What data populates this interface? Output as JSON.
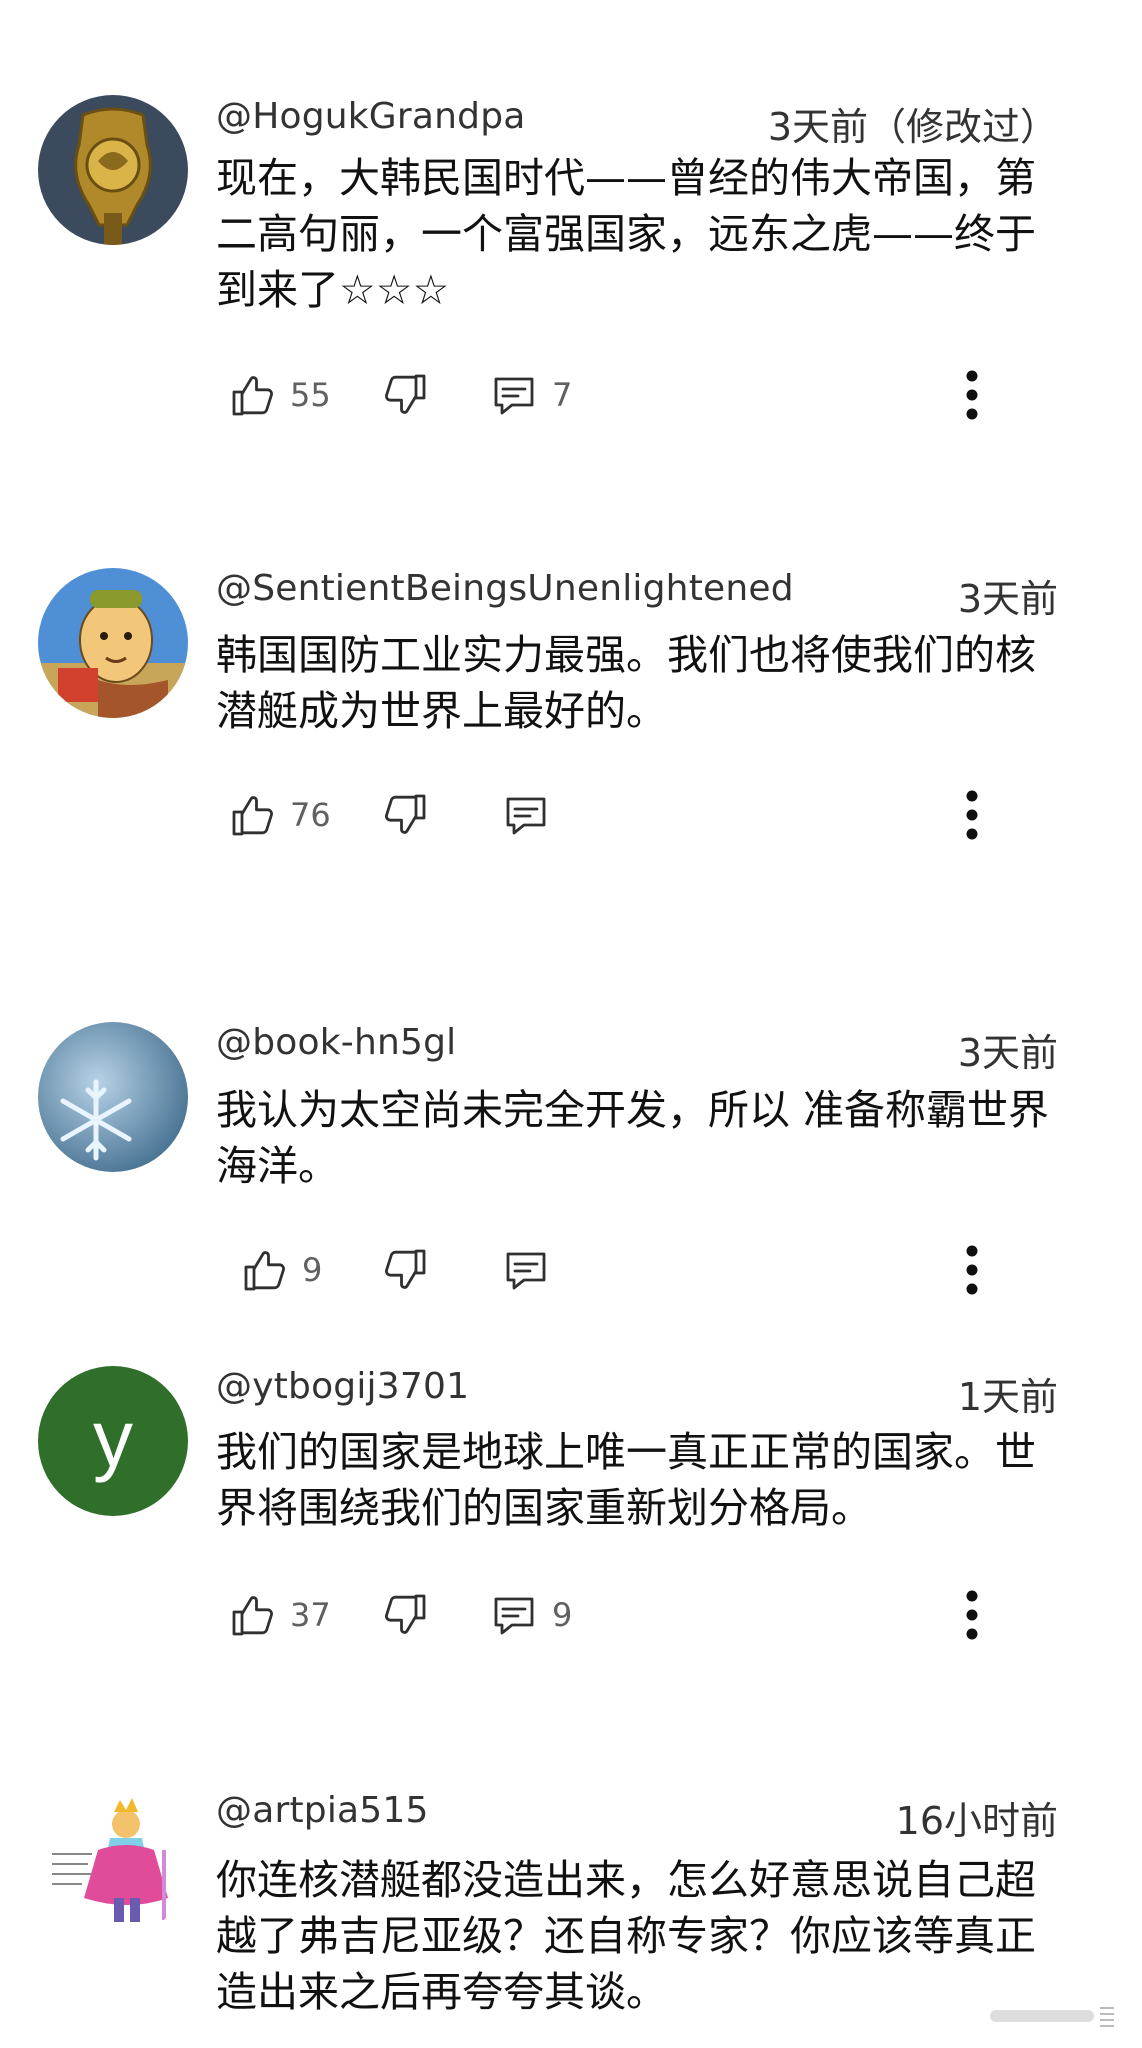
{
  "comments": [
    {
      "handle": "@HogukGrandpa",
      "time": "3天前（修改过）",
      "text": "现在，大韩民国时代——曾经的伟大帝国，第二高句丽，一个富强国家，远东之虎——终于到来了☆☆☆",
      "likes": "55",
      "replies": "7",
      "avatar": "golden-emblem"
    },
    {
      "handle": "@SentientBeingsUnenlightened",
      "time": "3天前",
      "text": "韩国国防工业实力最强。我们也将使我们的核潜艇成为世界上最好的。",
      "likes": "76",
      "replies": "",
      "avatar": "cartoon-monk"
    },
    {
      "handle": "@book-hn5gl",
      "time": "3天前",
      "text": "我认为太空尚未完全开发，所以 准备称霸世界海洋。",
      "likes": "9",
      "replies": "",
      "avatar": "snowflake"
    },
    {
      "handle": "@ytbogij3701",
      "time": "1天前",
      "text": "我们的国家是地球上唯一真正正常的国家。世界将围绕我们的国家重新划分格局。",
      "likes": "37",
      "replies": "9",
      "avatar": "letter-y",
      "avatar_letter": "y",
      "avatar_color": "#2f6f2a"
    },
    {
      "handle": "@artpia515",
      "time": "16小时前",
      "text": "你连核潜艇都没造出来，怎么好意思说自己超越了弗吉尼亚级？还自称专家？你应该等真正造出来之后再夸夸其谈。",
      "avatar": "little-prince"
    }
  ],
  "icons": {
    "like": "thumbs-up-icon",
    "dislike": "thumbs-down-icon",
    "reply": "comment-icon",
    "more": "more-vert-icon"
  },
  "colors": {
    "icon": "#303030",
    "count": "#606060",
    "text": "#111111"
  }
}
